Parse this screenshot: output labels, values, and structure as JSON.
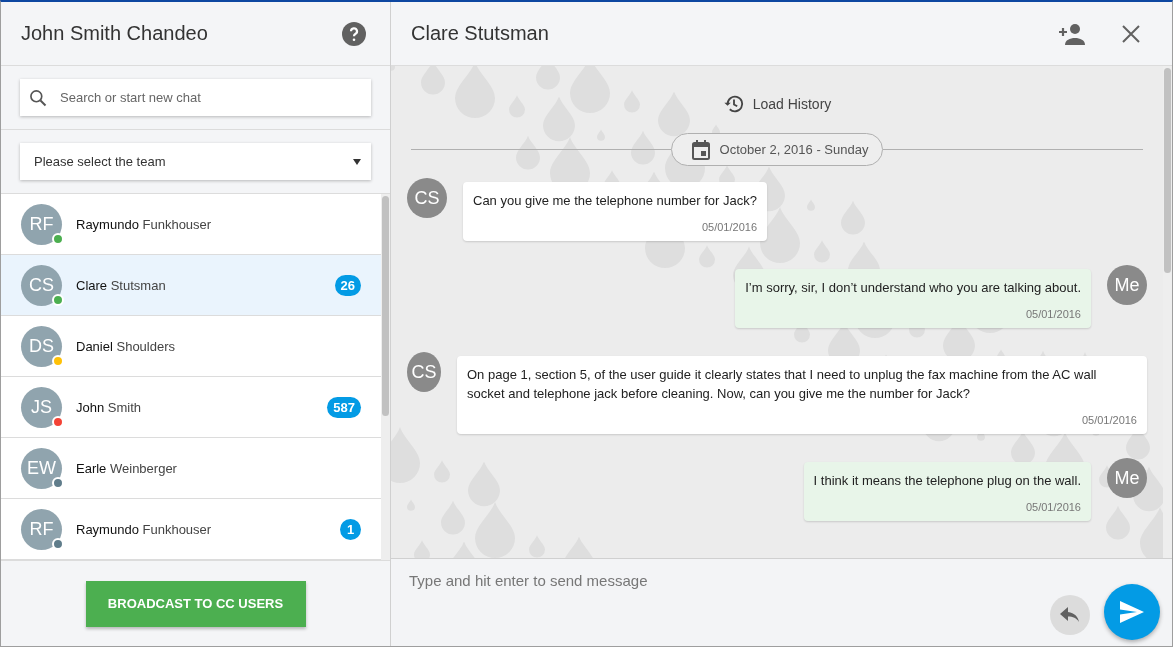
{
  "user": {
    "name": "John Smith Chandeo"
  },
  "search": {
    "placeholder": "Search or start new chat"
  },
  "team_select": {
    "value": "Please select the team"
  },
  "contacts": [
    {
      "initials": "RF",
      "first": "Raymundo",
      "last": "Funkhouser",
      "color": "#4caf50",
      "selected": false
    },
    {
      "initials": "CS",
      "first": "Clare",
      "last": "Stutsman",
      "color": "#4caf50",
      "selected": true,
      "unread": "26"
    },
    {
      "initials": "DS",
      "first": "Daniel",
      "last": "Shoulders",
      "color": "#ffc107",
      "selected": false
    },
    {
      "initials": "JS",
      "first": "John",
      "last": "Smith",
      "color": "#f44336",
      "selected": false,
      "unread": "587"
    },
    {
      "initials": "EW",
      "first": "Earle",
      "last": "Weinberger",
      "color": "#607d8b",
      "selected": false
    },
    {
      "initials": "RF",
      "first": "Raymundo",
      "last": "Funkhouser",
      "color": "#607d8b",
      "selected": false,
      "unread": "1"
    }
  ],
  "broadcast_button": "BROADCAST TO CC USERS",
  "chat": {
    "title": "Clare Stutsman",
    "load_history": "Load History",
    "date": "October 2, 2016 - Sunday",
    "messages": [
      {
        "kind": "incoming",
        "avatar": "CS",
        "text": "Can you give me the telephone number for Jack?",
        "time": "05/01/2016"
      },
      {
        "kind": "outgoing",
        "avatar": "Me",
        "text": "I’m sorry, sir, I don’t understand who you are talking about.",
        "time": "05/01/2016"
      },
      {
        "kind": "incoming",
        "avatar": "CS",
        "text": "On page 1, section 5, of the user guide it clearly  states that I need to unplug the fax machine from the AC wall socket and telephone jack before cleaning. Now, can you give me the number for Jack?",
        "time": "05/01/2016"
      },
      {
        "kind": "outgoing",
        "avatar": "Me",
        "text": "I think it means the telephone plug on the wall.",
        "time": "05/01/2016"
      }
    ],
    "composer": {
      "placeholder": "Type and hit enter to send message"
    }
  }
}
